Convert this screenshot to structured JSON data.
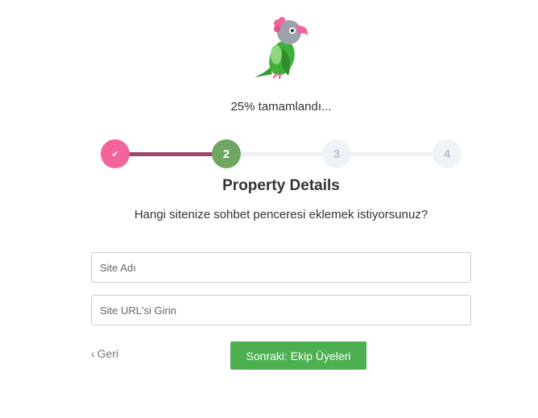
{
  "brand": {
    "logo_icon": "parrot-logo-icon"
  },
  "progress": {
    "text": "25% tamamlandı...",
    "percent": 25
  },
  "stepper": {
    "steps": [
      {
        "label": "✔",
        "state": "completed",
        "color": "#f2649b"
      },
      {
        "label": "2",
        "state": "active",
        "color": "#6ea860"
      },
      {
        "label": "3",
        "state": "pending",
        "color": "#eef3f7"
      },
      {
        "label": "4",
        "state": "pending",
        "color": "#eef3f7"
      }
    ],
    "completed_track_color": "#9c466f"
  },
  "section": {
    "title": "Property Details",
    "question": "Hangi sitenize sohbet penceresi eklemek istiyorsunuz?"
  },
  "form": {
    "site_name": {
      "value": "",
      "placeholder": "Site Adı"
    },
    "site_url": {
      "value": "",
      "placeholder": "Site URL'si Girin"
    }
  },
  "actions": {
    "back_label": "Geri",
    "next_label": "Sonraki: Ekip Üyeleri",
    "next_color": "#4caf50"
  }
}
